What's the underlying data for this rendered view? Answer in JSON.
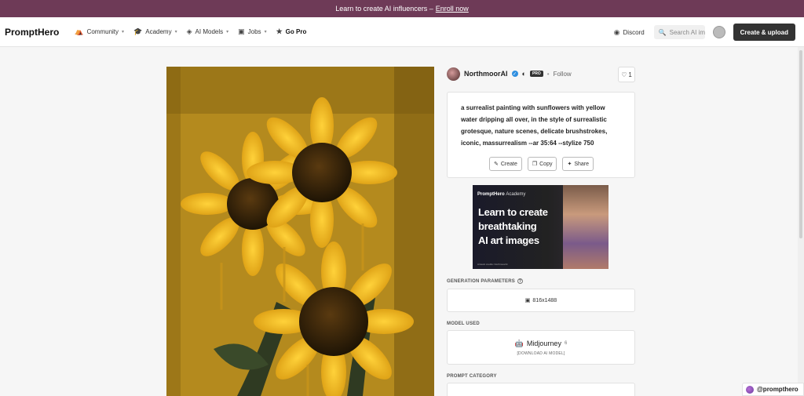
{
  "banner": {
    "text": "Learn to create AI influencers –",
    "link": "Enroll now"
  },
  "nav": {
    "logo": "PromptHero",
    "items": [
      {
        "label": "Community",
        "icon": "triangle-people-icon",
        "dropdown": true
      },
      {
        "label": "Academy",
        "icon": "graduation-cap-icon",
        "dropdown": true
      },
      {
        "label": "AI Models",
        "icon": "cube-icon",
        "dropdown": true
      },
      {
        "label": "Jobs",
        "icon": "briefcase-icon",
        "dropdown": true
      },
      {
        "label": "Go Pro",
        "icon": "star-icon",
        "dropdown": false
      }
    ],
    "discord": "Discord",
    "search_placeholder": "Search AI images",
    "create_upload": "Create & upload"
  },
  "author": {
    "name": "NorthmoorAI",
    "badge": "PRO",
    "follow": "Follow",
    "likes": "1"
  },
  "prompt": {
    "text": "a surrealist painting with sunflowers with yellow water dripping all over, in the style of surrealistic grotesque, nature scenes, delicate brushstrokes, iconic, massurrealism --ar 35:64 --stylize 750",
    "actions": {
      "create": "Create",
      "copy": "Copy",
      "share": "Share"
    }
  },
  "ad": {
    "brand": "PromptHero",
    "brand_suffix": "Academy",
    "lines": [
      "Learn to create",
      "breathtaking",
      "AI art images"
    ],
    "credit": "Artwork credits: NorthmoorAI"
  },
  "sections": {
    "generation_parameters": "GENERATION PARAMETERS",
    "model_used": "MODEL USED",
    "prompt_category": "PROMPT CATEGORY"
  },
  "params": {
    "dimensions": "816x1488"
  },
  "model": {
    "name": "Midjourney",
    "version": "6",
    "download": "[DOWNLOAD AI MODEL]"
  },
  "watermark": "@prompthero",
  "colors": {
    "banner": "#6e3a57",
    "create_button": "#333333",
    "verified": "#2f8fe0"
  }
}
